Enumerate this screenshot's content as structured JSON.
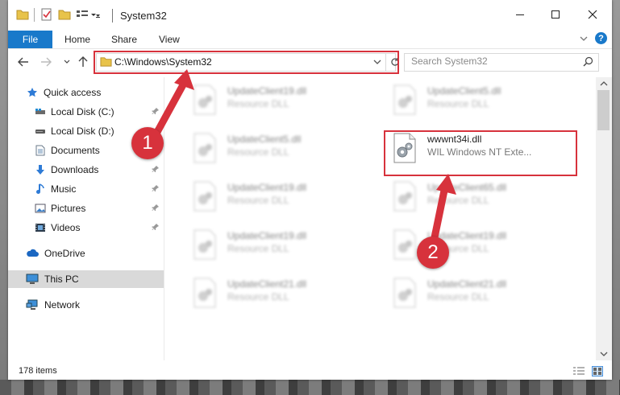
{
  "window": {
    "title": "System32",
    "controls": {
      "minimize": "—",
      "maximize": "☐",
      "close": "✕"
    }
  },
  "ribbon": {
    "file": "File",
    "tabs": [
      "Home",
      "Share",
      "View"
    ],
    "help": "?"
  },
  "navigation": {
    "address": "C:\\Windows\\System32",
    "search_placeholder": "Search System32"
  },
  "sidebar": {
    "items": [
      {
        "label": "Quick access",
        "icon": "star-icon",
        "pinned": false
      },
      {
        "label": "Local Disk (C:)",
        "icon": "drive-icon",
        "pinned": true
      },
      {
        "label": "Local Disk (D:)",
        "icon": "drive-icon",
        "pinned": true
      },
      {
        "label": "Documents",
        "icon": "document-icon",
        "pinned": true
      },
      {
        "label": "Downloads",
        "icon": "download-icon",
        "pinned": true
      },
      {
        "label": "Music",
        "icon": "music-icon",
        "pinned": true
      },
      {
        "label": "Pictures",
        "icon": "pictures-icon",
        "pinned": true
      },
      {
        "label": "Videos",
        "icon": "video-icon",
        "pinned": true
      },
      {
        "label": "OneDrive",
        "icon": "cloud-icon",
        "pinned": false
      },
      {
        "label": "This PC",
        "icon": "pc-icon",
        "pinned": false
      },
      {
        "label": "Network",
        "icon": "network-icon",
        "pinned": false
      }
    ],
    "selected": "This PC"
  },
  "files": {
    "left": [
      {
        "name": "UpdateClient19.dll",
        "desc": "Resource DLL"
      },
      {
        "name": "UpdateClient5.dll",
        "desc": "Resource DLL"
      },
      {
        "name": "UpdateClient19.dll",
        "desc": "Resource DLL"
      },
      {
        "name": "UpdateClient19.dll",
        "desc": "Resource DLL"
      },
      {
        "name": "UpdateClient21.dll",
        "desc": "Resource DLL"
      }
    ],
    "right": [
      {
        "name": "UpdateClient5.dll",
        "desc": "Resource DLL"
      },
      {
        "name": "wwwnt34i.dll",
        "desc": "WIL Windows NT Exte..."
      },
      {
        "name": "UpdateClient65.dll",
        "desc": "Resource DLL"
      },
      {
        "name": "UpdateClient19.dll",
        "desc": "Resource DLL"
      },
      {
        "name": "UpdateClient21.dll",
        "desc": "Resource DLL"
      }
    ]
  },
  "status": {
    "item_count": "178 items"
  },
  "callouts": {
    "step1": "1",
    "step2": "2"
  },
  "colors": {
    "accent": "#1979ca",
    "highlight": "#d7323c",
    "selected_bg": "#d9d9d9"
  }
}
